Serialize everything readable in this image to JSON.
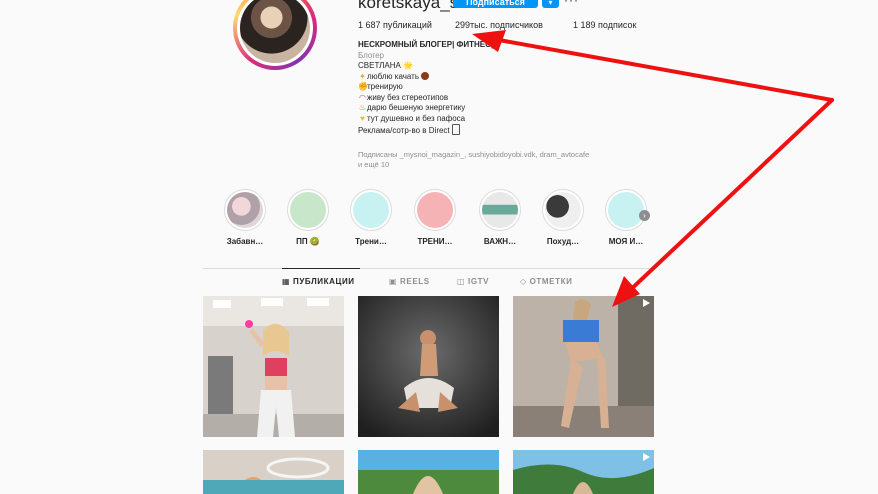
{
  "profile": {
    "username": "koretskaya_sv",
    "follow_label": "Подписаться",
    "dropdown_icon": "chevron-down-icon",
    "more_icon": "more-horizontal-icon",
    "more_label": "···"
  },
  "stats": {
    "posts": "1 687 публикаций",
    "followers": "299тыс. подписчиков",
    "following": "1 189 подписок"
  },
  "bio": {
    "title": "НЕСКРОМНЫЙ БЛОГЕР| ФИТНЕС| \"",
    "category": "Блогер",
    "name": "СВЕТЛАНА 🌟",
    "lines": [
      "люблю качать",
      "тренирую",
      "живу без стереотипов",
      "дарю бешеную энергетику",
      "тут душевно и без пафоса",
      "Реклама/сотр-во в Direct"
    ],
    "followed_by_1": "Подписаны _mysnoi_magazin_, sushiyobidoyobi.vdk, dram_avtocafe",
    "followed_by_2": "и ещё 10"
  },
  "highlights": [
    {
      "label": "Забавн…",
      "color": "#d9c3c8"
    },
    {
      "label": "ПП 🥝",
      "color": "#c8e6c9"
    },
    {
      "label": "Трени…",
      "color": "#c8f2f2"
    },
    {
      "label": "ТРЕНИ…",
      "color": "#f6b3b5"
    },
    {
      "label": "ВАЖН…",
      "color": "#6aa89a"
    },
    {
      "label": "Похуд…",
      "color": "#4b4b4b"
    },
    {
      "label": "МОЯ И…",
      "color": "#c8f2f2"
    }
  ],
  "tabs": [
    {
      "label": "ПУБЛИКАЦИИ",
      "icon": "grid-icon",
      "active": true
    },
    {
      "label": "REELS",
      "icon": "reels-icon",
      "active": false
    },
    {
      "label": "IGTV",
      "icon": "igtv-icon",
      "active": false
    },
    {
      "label": "ОТМЕТКИ",
      "icon": "tag-icon",
      "active": false
    }
  ],
  "colors": {
    "accent": "#0095f6",
    "annotation_arrow": "#ee1111",
    "story_ring": "#dd2a7b"
  }
}
